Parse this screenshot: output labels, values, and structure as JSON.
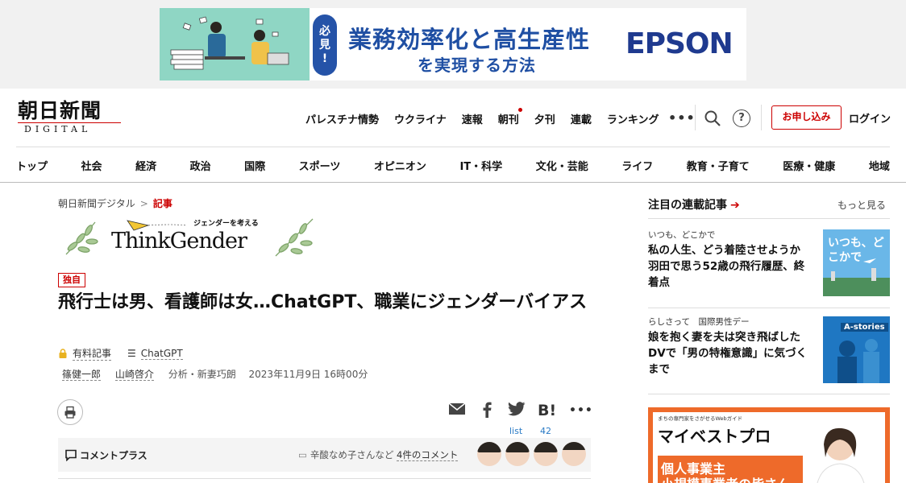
{
  "ad_top": {
    "badge": "必\n見\n!",
    "headline": "業務効率化と高生産性",
    "subline": "を実現する方法",
    "brand": "EPSON",
    "info_icon": "info-icon"
  },
  "header": {
    "logo_main": "朝日新聞",
    "logo_sub": "DIGITAL",
    "nav": [
      "パレスチナ情勢",
      "ウクライナ",
      "速報",
      "朝刊",
      "夕刊",
      "連載",
      "ランキング"
    ],
    "more": "•••",
    "help": "?",
    "signup": "お申し込み",
    "login": "ログイン"
  },
  "categories": [
    "トップ",
    "社会",
    "経済",
    "政治",
    "国際",
    "スポーツ",
    "オピニオン",
    "IT・科学",
    "文化・芸能",
    "ライフ",
    "教育・子育て",
    "医療・健康",
    "地域"
  ],
  "breadcrumb": {
    "home": "朝日新聞デジタル",
    "sep": ">",
    "current": "記事"
  },
  "series_banner": {
    "title": "ThinkGender",
    "subtitle": "ジェンダーを考える"
  },
  "article": {
    "exclusive": "独自",
    "headline": "飛行士は男、看護師は女…ChatGPT、職業にジェンダーバイアス",
    "paid": "有料記事",
    "tag": "ChatGPT",
    "author1": "篠健一郎",
    "author2": "山崎啓介",
    "analysis": "分析・新妻巧朗",
    "date": "2023年11月9日 16時00分",
    "list_label": "list",
    "hatena_count": "42",
    "hatena_label": "B!"
  },
  "comment_bar": {
    "label": "コメントプラス",
    "prefix": "辛酸なめ子さんなど",
    "count_link": "4件のコメント"
  },
  "sidebar": {
    "heading": "注目の連載記事",
    "arrow": "➔",
    "more": "もっと見る",
    "items": [
      {
        "kicker": "いつも、どこかで",
        "title": "私の人生、どう着陸させようか　羽田で思う52歳の飛行履歴、終着点",
        "thumb_text": "いつも、どこかで"
      },
      {
        "kicker": "らしさって　国際男性デー",
        "title": "娘を抱く妻を夫は突き飛ばした　DVで「男の特権意識」に気づくまで",
        "thumb_text": "A-stories"
      }
    ],
    "ad": {
      "small": "まちの専門家をさがせるWebガイド",
      "logo": "マイベストプロ",
      "line1": "個人事業主",
      "line2": "小規模事業者の皆さん"
    }
  },
  "colors": {
    "brand_red": "#cc0000",
    "ad_blue": "#1f4fa3",
    "ad_orange": "#ee6a2a"
  }
}
